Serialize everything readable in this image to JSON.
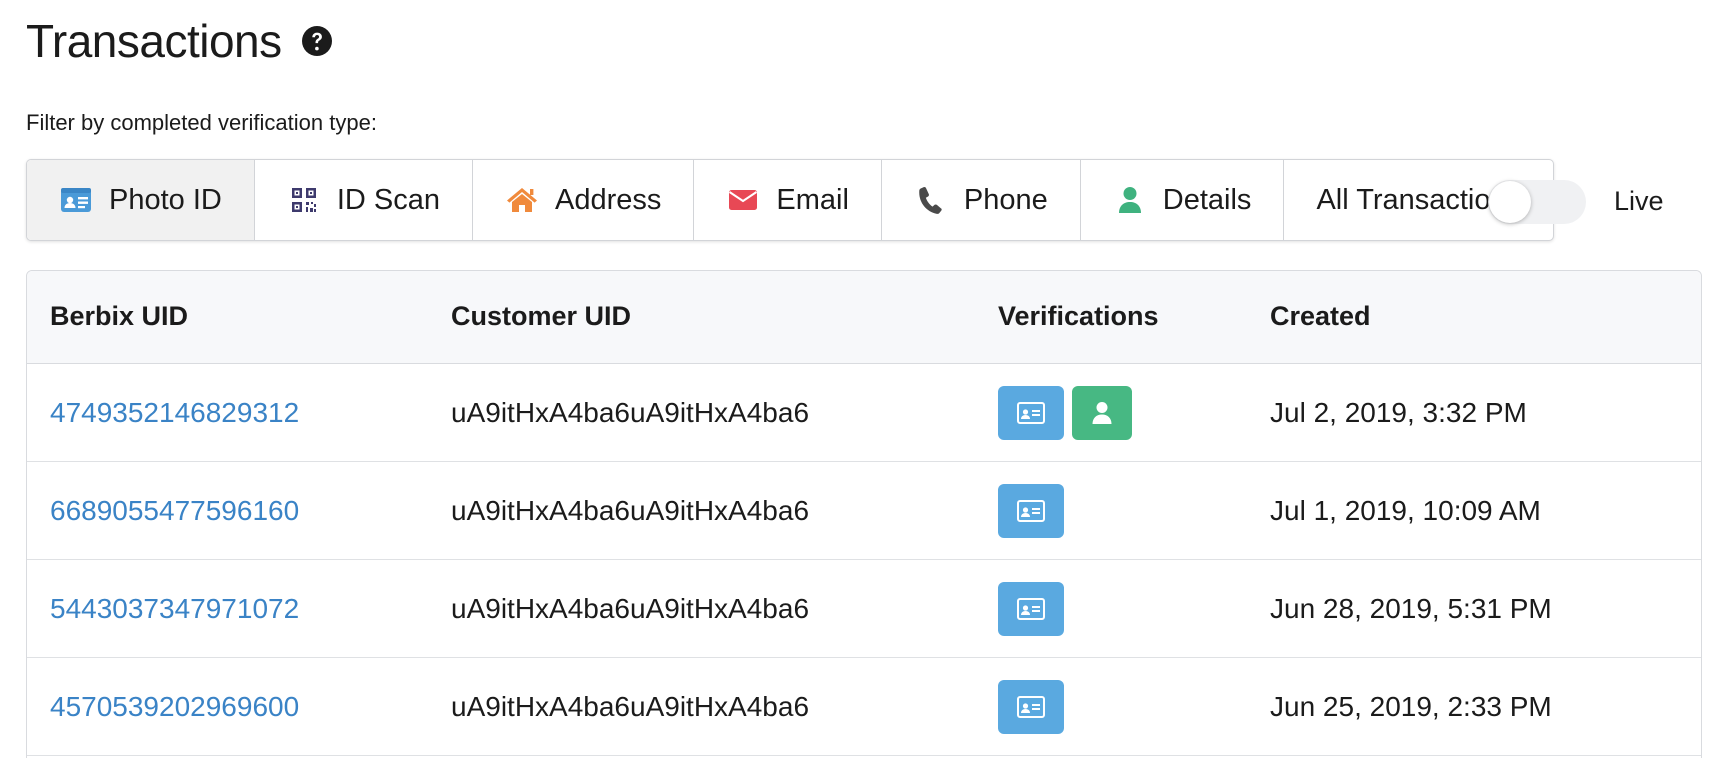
{
  "header": {
    "title": "Transactions"
  },
  "filter": {
    "label": "Filter by completed verification type:",
    "buttons": [
      {
        "label": "Photo ID",
        "icon": "id-card-icon",
        "color": "#4a9ad8",
        "active": true
      },
      {
        "label": "ID Scan",
        "icon": "qr-code-icon",
        "color": "#3e3a6d",
        "active": false
      },
      {
        "label": "Address",
        "icon": "home-icon",
        "color": "#f08a3c",
        "active": false
      },
      {
        "label": "Email",
        "icon": "envelope-icon",
        "color": "#e84855",
        "active": false
      },
      {
        "label": "Phone",
        "icon": "phone-icon",
        "color": "#4a4a4a",
        "active": false
      },
      {
        "label": "Details",
        "icon": "user-icon",
        "color": "#3fb27f",
        "active": false
      },
      {
        "label": "All Transactions",
        "icon": "",
        "color": "",
        "active": false
      }
    ]
  },
  "live_toggle": {
    "label": "Live",
    "on": false
  },
  "table": {
    "columns": [
      "Berbix UID",
      "Customer UID",
      "Verifications",
      "Created"
    ],
    "rows": [
      {
        "berbix_uid": "4749352146829312",
        "customer_uid": "uA9itHxA4ba6uA9itHxA4ba6",
        "verifications": [
          "photo-id",
          "details"
        ],
        "created": "Jul 2, 2019, 3:32 PM"
      },
      {
        "berbix_uid": "6689055477596160",
        "customer_uid": "uA9itHxA4ba6uA9itHxA4ba6",
        "verifications": [
          "photo-id"
        ],
        "created": "Jul 1, 2019, 10:09 AM"
      },
      {
        "berbix_uid": "5443037347971072",
        "customer_uid": "uA9itHxA4ba6uA9itHxA4ba6",
        "verifications": [
          "photo-id"
        ],
        "created": "Jun 28, 2019, 5:31 PM"
      },
      {
        "berbix_uid": "4570539202969600",
        "customer_uid": "uA9itHxA4ba6uA9itHxA4ba6",
        "verifications": [
          "photo-id"
        ],
        "created": "Jun 25, 2019, 2:33 PM"
      }
    ]
  },
  "colors": {
    "link": "#3a83c6",
    "photo_badge": "#5aa9e0",
    "details_badge": "#47b883"
  }
}
